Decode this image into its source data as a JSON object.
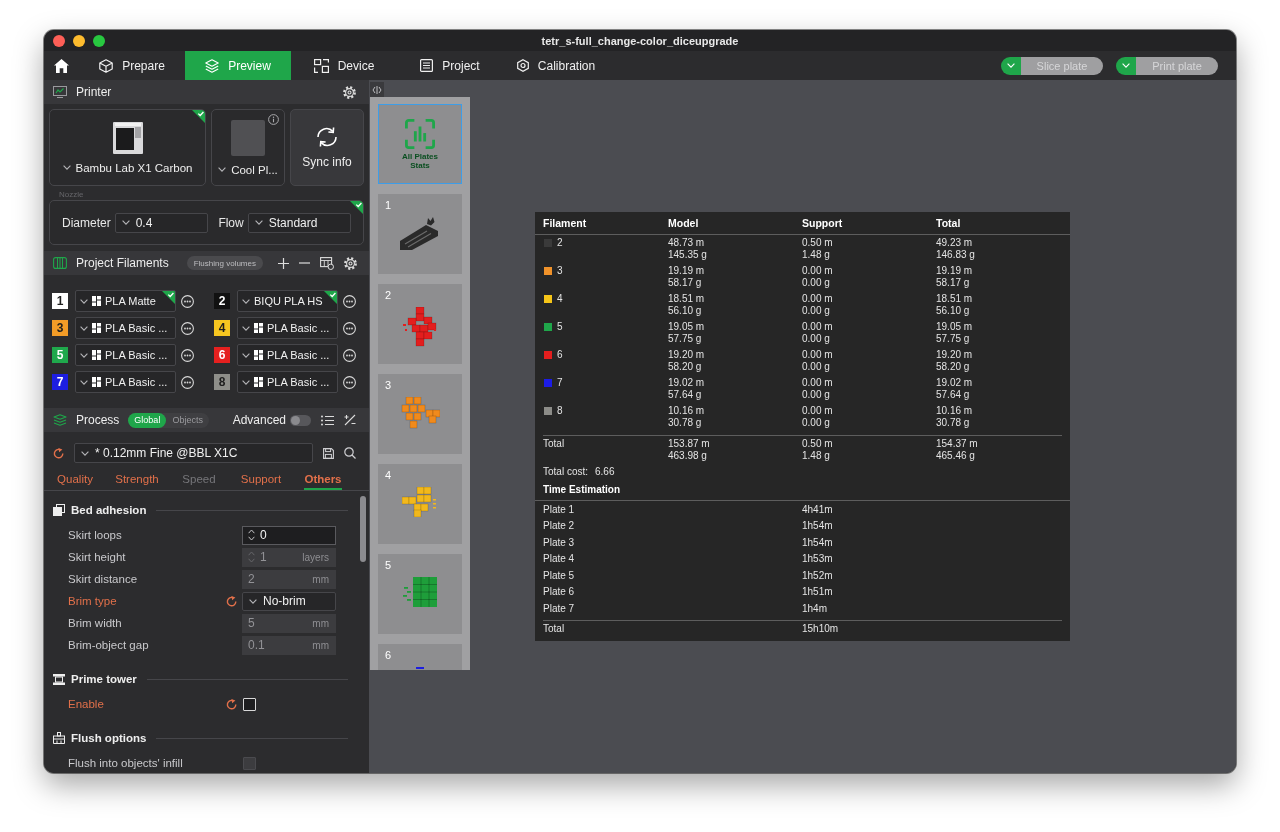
{
  "window": {
    "title": "tetr_s-full_change-color_diceupgrade"
  },
  "toolbar": {
    "tabs": [
      {
        "label": "Prepare",
        "selected": false
      },
      {
        "label": "Preview",
        "selected": true
      },
      {
        "label": "Device",
        "selected": false
      },
      {
        "label": "Project",
        "selected": false
      },
      {
        "label": "Calibration",
        "selected": false
      }
    ],
    "actions": [
      {
        "label": "Slice plate",
        "disabled": true
      },
      {
        "label": "Print plate",
        "disabled": true
      }
    ]
  },
  "printer": {
    "title": "Printer",
    "name": "Bambu Lab X1 Carbon",
    "synced": true,
    "plate": "Cool Pl...",
    "sync_label": "Sync info",
    "nozzle": {
      "title": "Nozzle",
      "synced": true,
      "diameter_label": "Diameter",
      "diameter": "0.4",
      "flow_label": "Flow",
      "flow": "Standard"
    }
  },
  "filaments": {
    "title": "Project Filaments",
    "flushing_label": "Flushing volumes",
    "items": [
      {
        "number": "1",
        "color": "#ffffff",
        "kind": "bambu",
        "name": "PLA Matte",
        "synced": true
      },
      {
        "number": "2",
        "color": "#111111",
        "kind": "generic",
        "name": "BIQU PLA HS",
        "synced": true
      },
      {
        "number": "3",
        "color": "#f39c27",
        "kind": "bambu",
        "name": "PLA Basic ...",
        "synced": false
      },
      {
        "number": "4",
        "color": "#f6c620",
        "kind": "bambu",
        "name": "PLA Basic ...",
        "synced": false
      },
      {
        "number": "5",
        "color": "#1fa84c",
        "kind": "bambu",
        "name": "PLA Basic ...",
        "synced": false
      },
      {
        "number": "6",
        "color": "#e5201f",
        "kind": "bambu",
        "name": "PLA Basic ...",
        "synced": false
      },
      {
        "number": "7",
        "color": "#1d1ee0",
        "kind": "bambu",
        "name": "PLA Basic ...",
        "synced": false
      },
      {
        "number": "8",
        "color": "#8e8e89",
        "kind": "bambu",
        "name": "PLA Basic ...",
        "synced": false
      }
    ]
  },
  "process": {
    "title": "Process",
    "scope": [
      {
        "label": "Global",
        "selected": true
      },
      {
        "label": "Objects",
        "selected": false
      }
    ],
    "advanced_label": "Advanced",
    "advanced_on": false,
    "preset": "* 0.12mm Fine @BBL X1C",
    "preset_modified": true,
    "tabs": [
      {
        "label": "Quality",
        "selected": false,
        "modified": true
      },
      {
        "label": "Strength",
        "selected": false,
        "modified": true
      },
      {
        "label": "Speed",
        "selected": false,
        "modified": false
      },
      {
        "label": "Support",
        "selected": false,
        "modified": true
      },
      {
        "label": "Others",
        "selected": true,
        "modified": true
      }
    ],
    "groups": [
      {
        "title": "Bed adhesion",
        "settings": [
          {
            "kind": "spin",
            "label": "Skirt loops",
            "value": "0",
            "disabled": false,
            "modified": false
          },
          {
            "kind": "spin",
            "label": "Skirt height",
            "value": "1",
            "unit": "layers",
            "disabled": true,
            "modified": false
          },
          {
            "kind": "number",
            "label": "Skirt distance",
            "value": "2",
            "unit": "mm",
            "disabled": true,
            "modified": false
          },
          {
            "kind": "dropdown",
            "label": "Brim type",
            "value": "No-brim",
            "disabled": false,
            "modified": true
          },
          {
            "kind": "number",
            "label": "Brim width",
            "value": "5",
            "unit": "mm",
            "disabled": true,
            "modified": false
          },
          {
            "kind": "number",
            "label": "Brim-object gap",
            "value": "0.1",
            "unit": "mm",
            "disabled": true,
            "modified": false
          }
        ]
      },
      {
        "title": "Prime tower",
        "settings": [
          {
            "kind": "checkbox",
            "label": "Enable",
            "checked": false,
            "disabled": false,
            "modified": true
          }
        ]
      },
      {
        "title": "Flush options",
        "settings": [
          {
            "kind": "checkbox",
            "label": "Flush into objects' infill",
            "checked": false,
            "disabled": true,
            "modified": false
          }
        ]
      }
    ]
  },
  "plates": [
    {
      "kind": "stats",
      "label": "All Plates Stats",
      "selected": true
    },
    {
      "kind": "plate",
      "number": "1",
      "color": "#2a2a2a",
      "selected": false
    },
    {
      "kind": "plate",
      "number": "2",
      "color": "#e31e1e",
      "selected": false
    },
    {
      "kind": "plate",
      "number": "3",
      "color": "#f08a1c",
      "selected": false
    },
    {
      "kind": "plate",
      "number": "4",
      "color": "#f2b81c",
      "selected": false
    },
    {
      "kind": "plate",
      "number": "5",
      "color": "#1e9e3a",
      "selected": false
    },
    {
      "kind": "plate",
      "number": "6",
      "color": "#1d1ee0",
      "selected": false
    }
  ],
  "stats": {
    "columns": [
      "Filament",
      "Model",
      "Support",
      "Total"
    ],
    "rows": [
      {
        "filament": "2",
        "color": "#3a3a3a",
        "model": [
          "48.73 m",
          "145.35 g"
        ],
        "support": [
          "0.50 m",
          "1.48 g"
        ],
        "total": [
          "49.23 m",
          "146.83 g"
        ]
      },
      {
        "filament": "3",
        "color": "#f0922a",
        "model": [
          "19.19 m",
          "58.17 g"
        ],
        "support": [
          "0.00 m",
          "0.00 g"
        ],
        "total": [
          "19.19 m",
          "58.17 g"
        ]
      },
      {
        "filament": "4",
        "color": "#f5c518",
        "model": [
          "18.51 m",
          "56.10 g"
        ],
        "support": [
          "0.00 m",
          "0.00 g"
        ],
        "total": [
          "18.51 m",
          "56.10 g"
        ]
      },
      {
        "filament": "5",
        "color": "#1fa64a",
        "model": [
          "19.05 m",
          "57.75 g"
        ],
        "support": [
          "0.00 m",
          "0.00 g"
        ],
        "total": [
          "19.05 m",
          "57.75 g"
        ]
      },
      {
        "filament": "6",
        "color": "#e31e1e",
        "model": [
          "19.20 m",
          "58.20 g"
        ],
        "support": [
          "0.00 m",
          "0.00 g"
        ],
        "total": [
          "19.20 m",
          "58.20 g"
        ]
      },
      {
        "filament": "7",
        "color": "#1c1ce6",
        "model": [
          "19.02 m",
          "57.64 g"
        ],
        "support": [
          "0.00 m",
          "0.00 g"
        ],
        "total": [
          "19.02 m",
          "57.64 g"
        ]
      },
      {
        "filament": "8",
        "color": "#8c8c88",
        "model": [
          "10.16 m",
          "30.78 g"
        ],
        "support": [
          "0.00 m",
          "0.00 g"
        ],
        "total": [
          "10.16 m",
          "30.78 g"
        ]
      }
    ],
    "total": {
      "label": "Total",
      "model": [
        "153.87 m",
        "463.98 g"
      ],
      "support": [
        "0.50 m",
        "1.48 g"
      ],
      "total": [
        "154.37 m",
        "465.46 g"
      ]
    },
    "cost_label": "Total cost:",
    "cost": "6.66",
    "time_title": "Time Estimation",
    "times": [
      {
        "label": "Plate 1",
        "time": "4h41m"
      },
      {
        "label": "Plate 2",
        "time": "1h54m"
      },
      {
        "label": "Plate 3",
        "time": "1h54m"
      },
      {
        "label": "Plate 4",
        "time": "1h53m"
      },
      {
        "label": "Plate 5",
        "time": "1h52m"
      },
      {
        "label": "Plate 6",
        "time": "1h51m"
      },
      {
        "label": "Plate 7",
        "time": "1h4m"
      }
    ],
    "time_total": {
      "label": "Total",
      "time": "15h10m"
    }
  }
}
